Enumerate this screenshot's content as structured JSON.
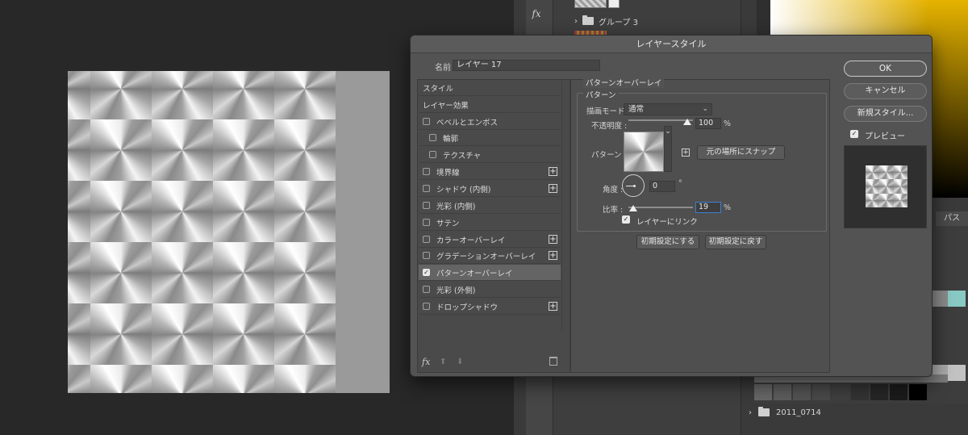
{
  "layers_panel": {
    "group_name": "グループ 3",
    "folder_name": "2011_0714",
    "path_tab": "パス"
  },
  "dialog": {
    "title": "レイヤースタイル",
    "name_label": "名前 :",
    "name_value": "レイヤー 17",
    "styles": [
      {
        "label": "スタイル",
        "has_checkbox": false
      },
      {
        "label": "レイヤー効果",
        "has_checkbox": false
      },
      {
        "label": "ベベルとエンボス",
        "has_checkbox": true,
        "checked": false
      },
      {
        "label": "輪郭",
        "has_checkbox": true,
        "checked": false,
        "indent": true
      },
      {
        "label": "テクスチャ",
        "has_checkbox": true,
        "checked": false,
        "indent": true
      },
      {
        "label": "境界線",
        "has_checkbox": true,
        "checked": false,
        "plus": true
      },
      {
        "label": "シャドウ (内側)",
        "has_checkbox": true,
        "checked": false,
        "plus": true
      },
      {
        "label": "光彩 (内側)",
        "has_checkbox": true,
        "checked": false
      },
      {
        "label": "サテン",
        "has_checkbox": true,
        "checked": false
      },
      {
        "label": "カラーオーバーレイ",
        "has_checkbox": true,
        "checked": false,
        "plus": true
      },
      {
        "label": "グラデーションオーバーレイ",
        "has_checkbox": true,
        "checked": false,
        "plus": true
      },
      {
        "label": "パターンオーバーレイ",
        "has_checkbox": true,
        "checked": true,
        "selected": true
      },
      {
        "label": "光彩 (外側)",
        "has_checkbox": true,
        "checked": false
      },
      {
        "label": "ドロップシャドウ",
        "has_checkbox": true,
        "checked": false,
        "plus": true
      }
    ],
    "section_title": "パターンオーバーレイ",
    "group_title": "パターン",
    "blend_mode_label": "描画モード :",
    "blend_mode_value": "通常",
    "opacity_label": "不透明度 :",
    "opacity_value": "100",
    "opacity_level": 1.0,
    "percent": "%",
    "pattern_label": "パターン :",
    "snap_button": "元の場所にスナップ",
    "angle_label": "角度 :",
    "angle_value": "0",
    "degree": "°",
    "scale_label": "比率 :",
    "scale_value": "19",
    "scale_level": 0.19,
    "link_label": "レイヤーにリンク",
    "link_checked": true,
    "make_default": "初期設定にする",
    "reset_default": "初期設定に戻す",
    "ok": "OK",
    "cancel": "キャンセル",
    "new_style": "新規スタイル...",
    "preview_label": "プレビュー",
    "preview_checked": true,
    "fx": "fx"
  },
  "colors": {
    "accent_focus": "#3b7fd6",
    "dialog_bg": "#535353",
    "app_bg": "#282828"
  }
}
